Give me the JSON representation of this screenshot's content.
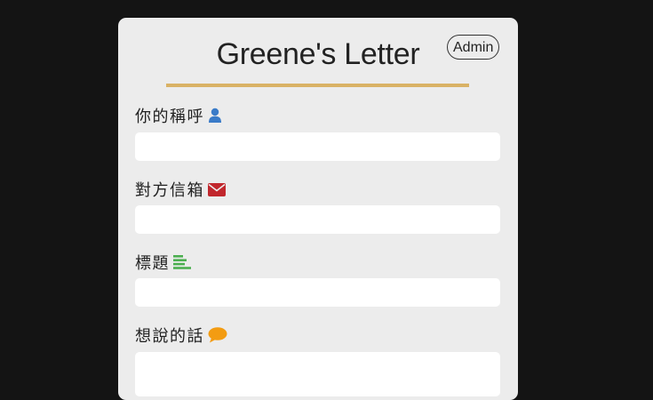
{
  "page": {
    "title": "Greene's Letter",
    "admin_label": "Admin"
  },
  "form": {
    "fields": [
      {
        "label": "你的稱呼",
        "icon": "user-icon",
        "icon_color": "#3a7bc8",
        "value": ""
      },
      {
        "label": "對方信箱",
        "icon": "envelope-icon",
        "icon_color": "#c1272d",
        "value": ""
      },
      {
        "label": "標題",
        "icon": "align-left-icon",
        "icon_color": "#4caf50",
        "value": ""
      },
      {
        "label": "想說的話",
        "icon": "speech-bubble-icon",
        "icon_color": "#f39c12",
        "value": ""
      }
    ]
  },
  "colors": {
    "background": "#141414",
    "card": "#ececec",
    "accent_rule": "#d9b265"
  }
}
